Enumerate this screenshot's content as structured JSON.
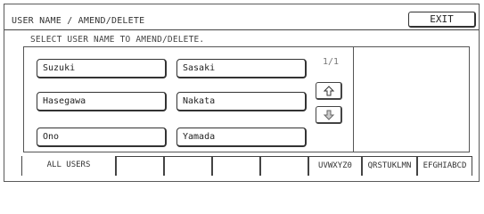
{
  "window": {
    "title": "USER NAME / AMEND/DELETE",
    "exit_label": "EXIT"
  },
  "instruction": "SELECT USER NAME TO AMEND/DELETE.",
  "users": {
    "col1": [
      "Suzuki",
      "Hasegawa",
      "Ono"
    ],
    "col2": [
      "Sasaki",
      "Nakata",
      "Yamada"
    ]
  },
  "pagination": {
    "indicator": "1/1",
    "up_icon": "up-arrow-icon",
    "down_icon": "down-arrow-icon"
  },
  "tabs": [
    "ALL USERS",
    "",
    "",
    "",
    "",
    "UVWXYZ0",
    "QRSTUKLMN",
    "EFGHIABCD"
  ]
}
